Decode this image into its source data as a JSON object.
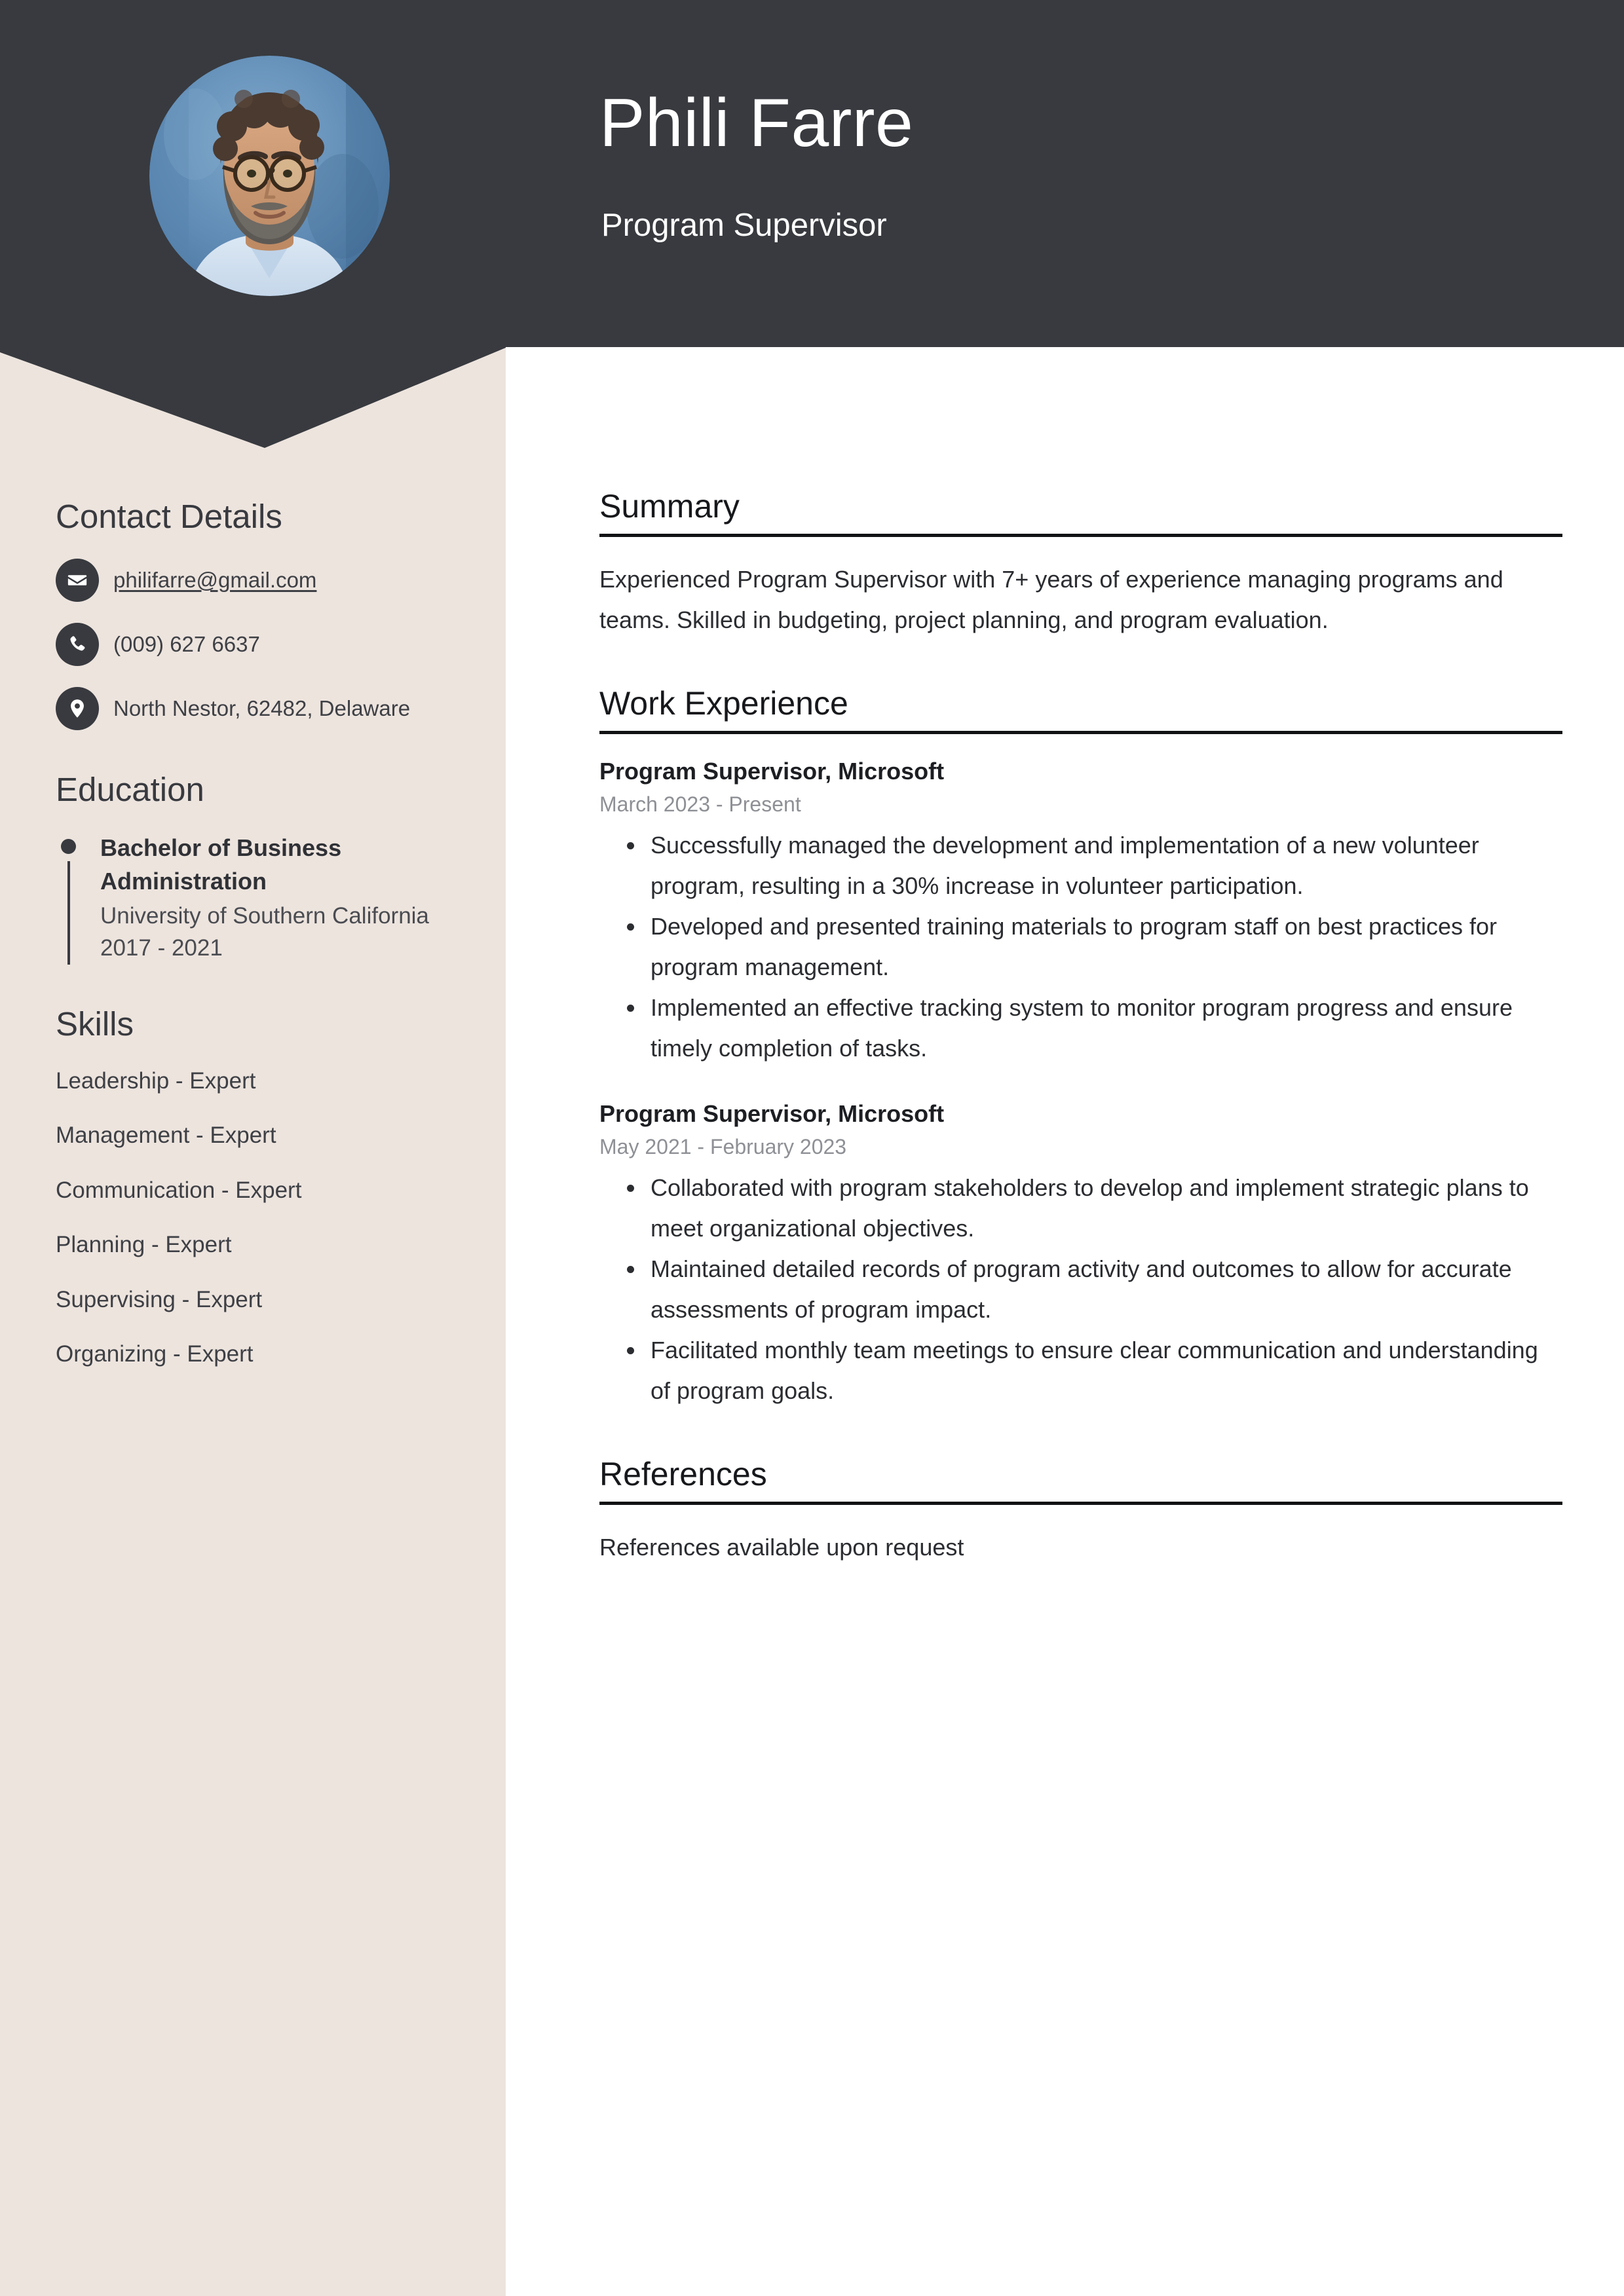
{
  "colors": {
    "dark": "#383A3F",
    "sidebar_bg": "#EDE4DE",
    "page_bg": "#FFFFFF",
    "muted_text": "#8E9095",
    "body_text": "#2B2D31"
  },
  "header": {
    "name": "Phili Farre",
    "job_title": "Program Supervisor",
    "photo_alt": "portrait-photo"
  },
  "sidebar": {
    "contact": {
      "heading": "Contact Details",
      "items": [
        {
          "icon": "email-icon",
          "value": "philifarre@gmail.com",
          "is_link": true
        },
        {
          "icon": "phone-icon",
          "value": "(009) 627 6637",
          "is_link": false
        },
        {
          "icon": "location-icon",
          "value": "North Nestor, 62482, Delaware",
          "is_link": false
        }
      ]
    },
    "education": {
      "heading": "Education",
      "items": [
        {
          "degree": "Bachelor of Business Administration",
          "school": "University of Southern California",
          "years": "2017 - 2021"
        }
      ]
    },
    "skills": {
      "heading": "Skills",
      "items": [
        "Leadership - Expert",
        "Management - Expert",
        "Communication - Expert",
        "Planning - Expert",
        "Supervising - Expert",
        "Organizing - Expert"
      ]
    }
  },
  "main": {
    "summary": {
      "heading": "Summary",
      "text": "Experienced Program Supervisor with 7+ years of experience managing programs and teams. Skilled in budgeting, project planning, and program evaluation."
    },
    "work_experience": {
      "heading": "Work Experience",
      "jobs": [
        {
          "role": "Program Supervisor, Microsoft",
          "dates": "March 2023 - Present",
          "bullets": [
            "Successfully managed the development and implementation of a new volunteer program, resulting in a 30% increase in volunteer participation.",
            "Developed and presented training materials to program staff on best practices for program management.",
            "Implemented an effective tracking system to monitor program progress and ensure timely completion of tasks."
          ]
        },
        {
          "role": "Program Supervisor, Microsoft",
          "dates": "May 2021 - February 2023",
          "bullets": [
            "Collaborated with program stakeholders to develop and implement strategic plans to meet organizational objectives.",
            "Maintained detailed records of program activity and outcomes to allow for accurate assessments of program impact.",
            "Facilitated monthly team meetings to ensure clear communication and understanding of program goals."
          ]
        }
      ]
    },
    "references": {
      "heading": "References",
      "text": "References available upon request"
    }
  }
}
